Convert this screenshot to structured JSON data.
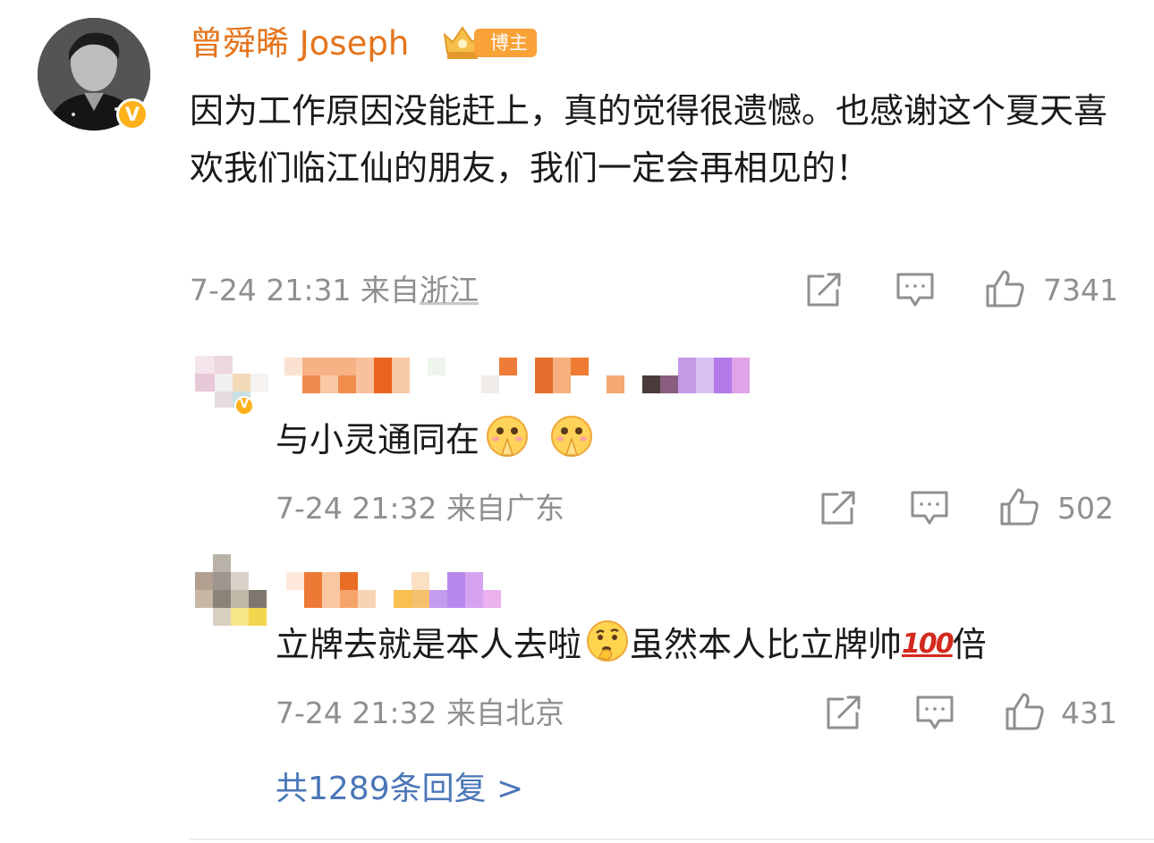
{
  "main_comment": {
    "username": "曾舜晞 Joseph",
    "badge_label": "博主",
    "verified_mark": "V",
    "text": "因为工作原因没能赶上，真的觉得很遗憾。也感谢这个夏天喜欢我们临江仙的朋友，我们一定会再相见的！",
    "time": "7-24 21:31",
    "from_label": "来自",
    "location": "浙江",
    "likes": "7341",
    "icons": [
      "share-icon",
      "comment-icon",
      "like-icon"
    ]
  },
  "replies": [
    {
      "text": "与小灵通同在",
      "emojis": [
        "pray-emoji",
        "pray-emoji"
      ],
      "time": "7-24 21:32",
      "from_label": "来自",
      "location": "广东",
      "likes": "502",
      "verified_mark": "V"
    },
    {
      "text_before": "立牌去就是本人去啦",
      "text_after": "虽然本人比立牌帅",
      "hundred": "100",
      "text_end": "倍",
      "emojis": [
        "thinking-emoji",
        "hundred-points-emoji"
      ],
      "time": "7-24 21:32",
      "from_label": "来自",
      "location": "北京",
      "likes": "431"
    }
  ],
  "more_replies": "共1289条回复 >",
  "colors": {
    "username": "#e5741b",
    "badge": "#f8a237",
    "verified": "#ffb11b",
    "meta": "#8f8f8f",
    "link": "#4a76b8"
  }
}
